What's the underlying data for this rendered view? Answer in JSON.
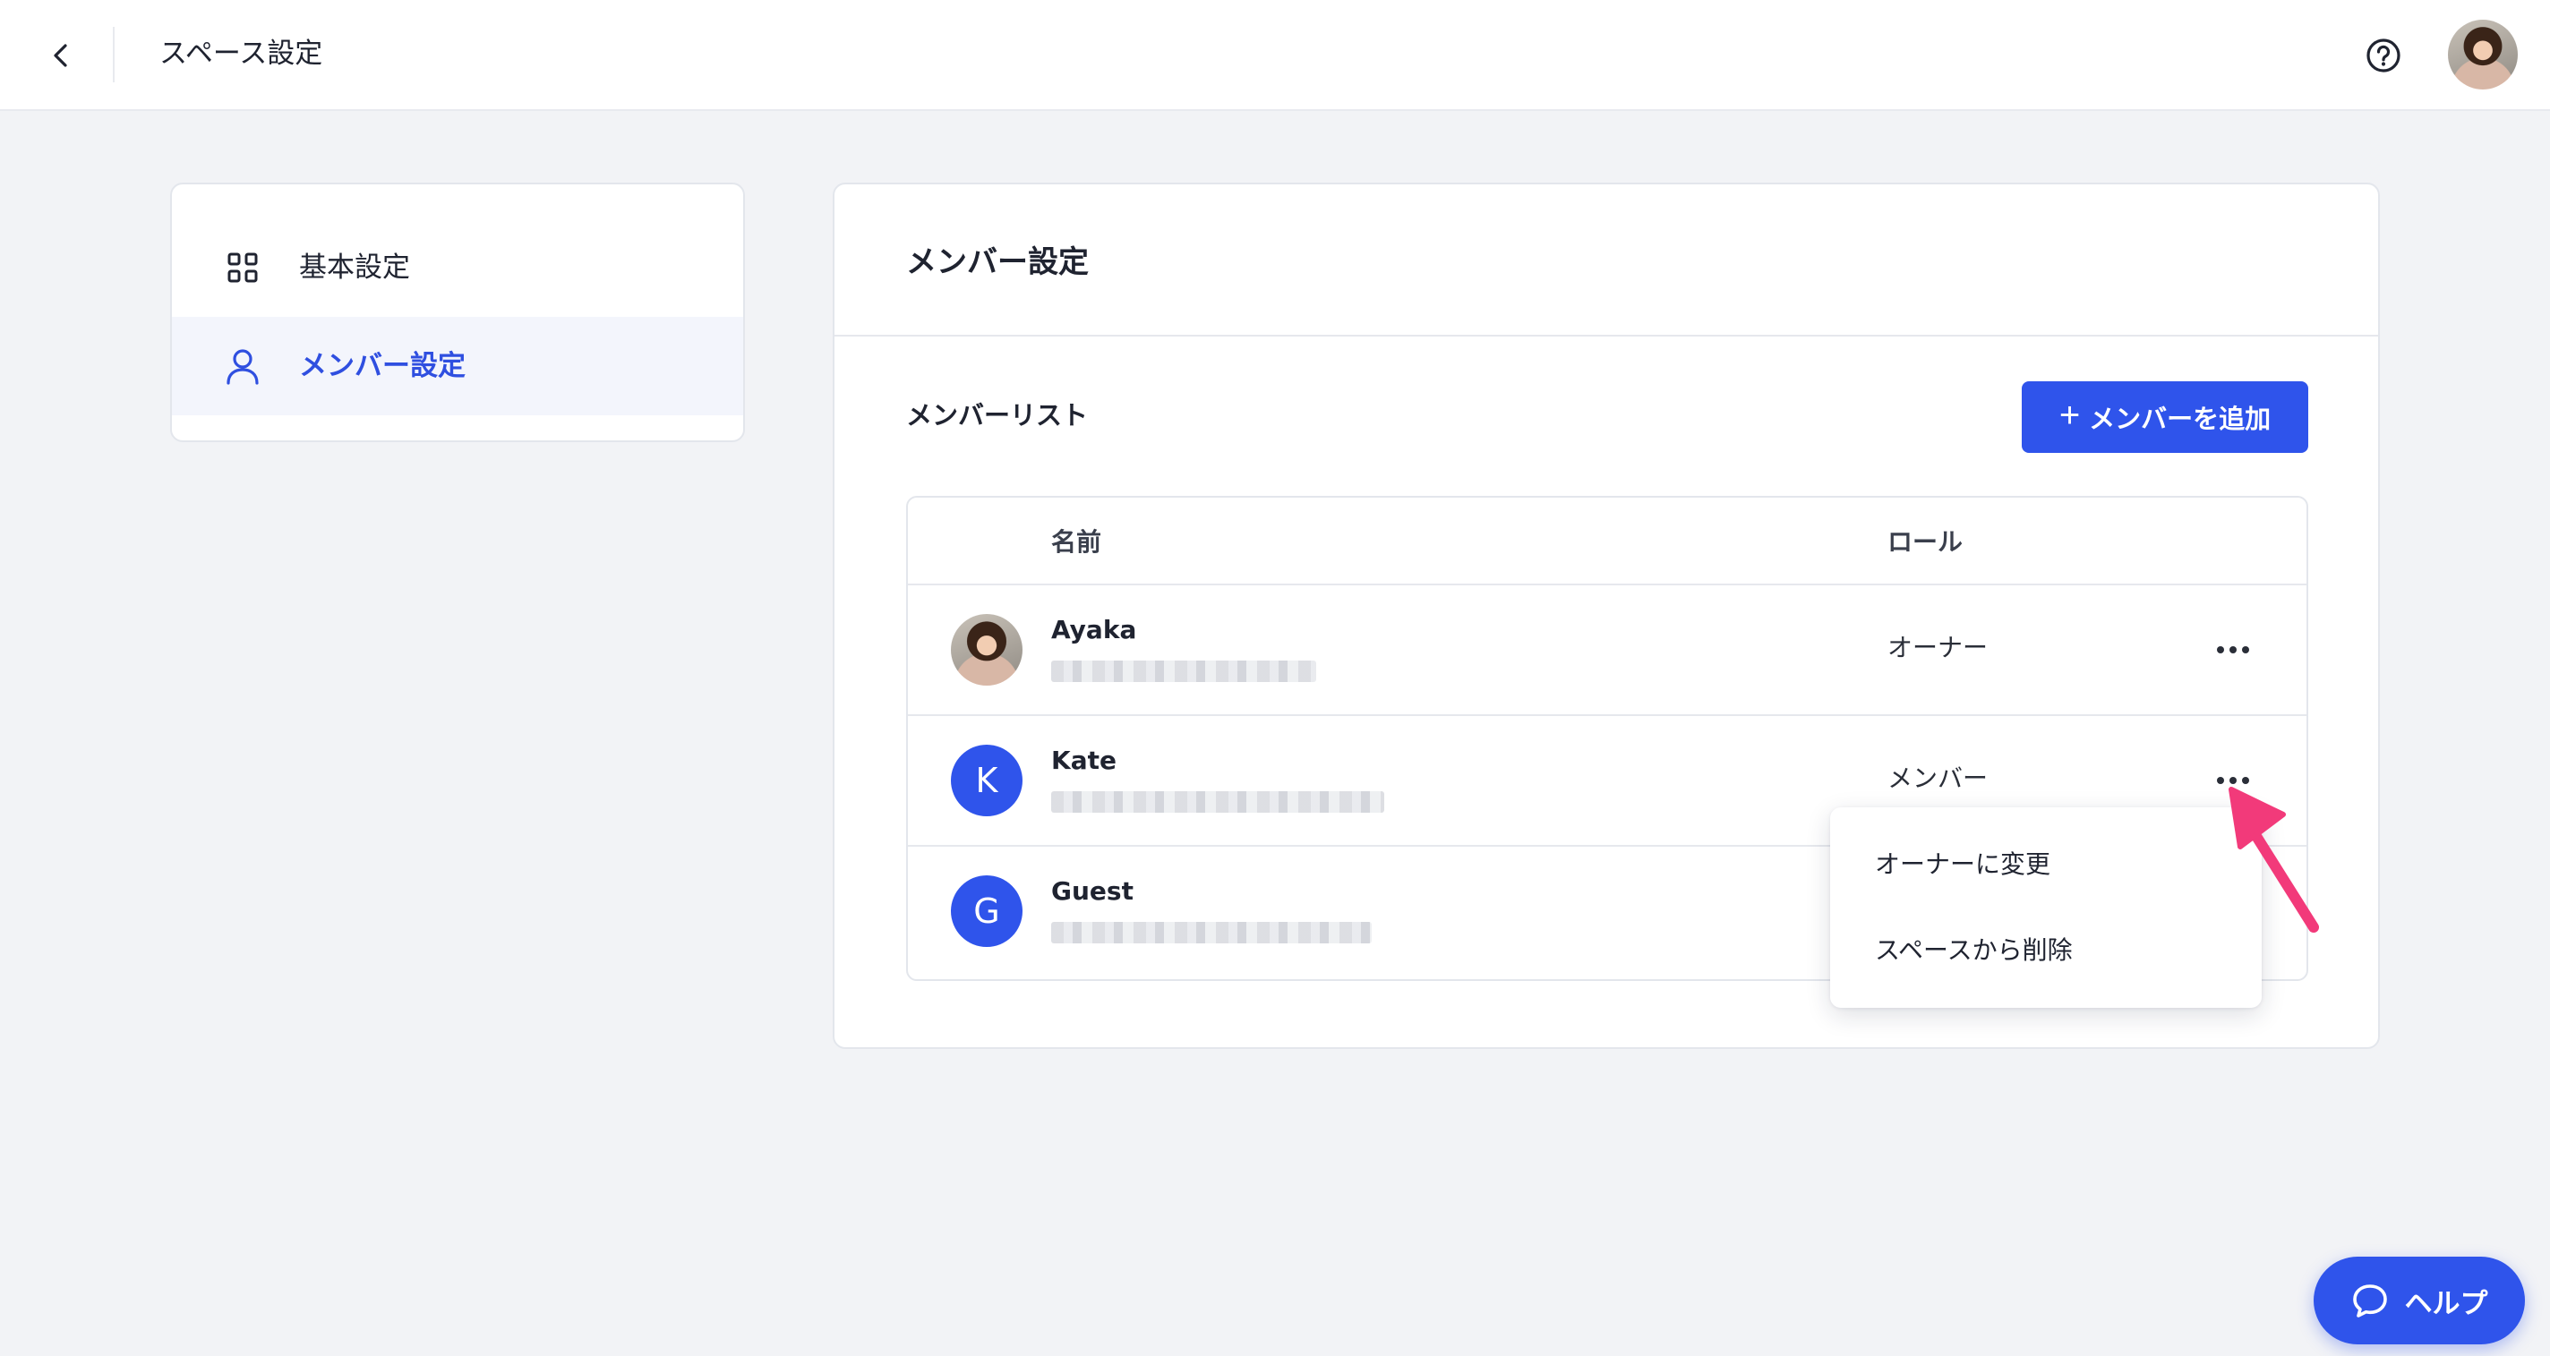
{
  "header": {
    "title": "スペース設定",
    "back_icon": "chevron-left-icon",
    "help_icon": "question-circle-icon"
  },
  "sidebar": {
    "items": [
      {
        "label": "基本設定",
        "icon": "grid-icon",
        "active": false
      },
      {
        "label": "メンバー設定",
        "icon": "user-icon",
        "active": true
      }
    ]
  },
  "main": {
    "title": "メンバー設定",
    "list_heading": "メンバーリスト",
    "add_button": {
      "plus": "+",
      "label": "メンバーを追加"
    },
    "table": {
      "columns": {
        "name": "名前",
        "role": "ロール"
      },
      "rows": [
        {
          "name": "Ayaka",
          "role": "オーナー",
          "avatar": "photo"
        },
        {
          "name": "Kate",
          "role": "メンバー",
          "avatar_letter": "K"
        },
        {
          "name": "Guest",
          "role": "",
          "avatar_letter": "G"
        }
      ]
    }
  },
  "dropdown": {
    "items": [
      {
        "label": "オーナーに変更"
      },
      {
        "label": "スペースから削除"
      }
    ]
  },
  "help_button": {
    "label": "ヘルプ",
    "icon": "chat-bubble-icon"
  },
  "colors": {
    "accent": "#2f54eb",
    "annotation_arrow": "#f23a7a",
    "background": "#f2f3f6"
  }
}
